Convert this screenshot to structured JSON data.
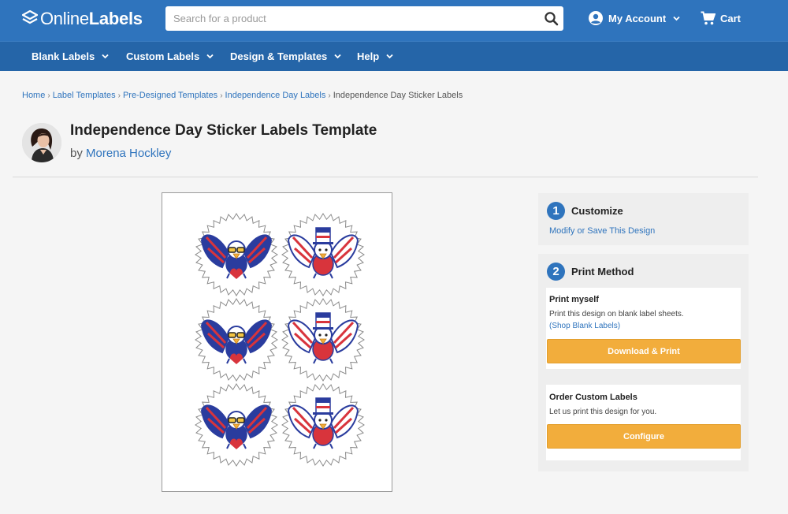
{
  "header": {
    "logo_light": "Online",
    "logo_bold": "Labels",
    "search_placeholder": "Search for a product",
    "account_label": "My Account",
    "cart_label": "Cart"
  },
  "nav": {
    "items": [
      {
        "label": "Blank Labels"
      },
      {
        "label": "Custom Labels"
      },
      {
        "label": "Design & Templates"
      },
      {
        "label": "Help"
      }
    ]
  },
  "breadcrumb": {
    "items": [
      "Home",
      "Label Templates",
      "Pre-Designed Templates",
      "Independence Day Labels"
    ],
    "current": "Independence Day Sticker Labels",
    "separator": "›"
  },
  "page": {
    "title": "Independence Day Sticker Labels Template",
    "by": "by",
    "author": "Morena Hockley"
  },
  "customize": {
    "number": "1",
    "title": "Customize",
    "link": "Modify or Save This Design"
  },
  "print_method": {
    "number": "2",
    "title": "Print Method",
    "print_myself": {
      "title": "Print myself",
      "description": "Print this design on blank label sheets.",
      "link": "(Shop Blank Labels)",
      "button": "Download & Print"
    },
    "order_custom": {
      "title": "Order Custom Labels",
      "description": "Let us print this design for you.",
      "button": "Configure"
    }
  },
  "colors": {
    "brand_blue": "#2f74bd",
    "nav_blue": "#2565a8",
    "button_orange": "#f2ad3c",
    "eagle_blue": "#2a3c9e",
    "eagle_red": "#d8343c"
  },
  "preview": {
    "label_count": 6,
    "designs": [
      "eagle-sunglasses",
      "eagle-top-hat",
      "eagle-sunglasses",
      "eagle-top-hat",
      "eagle-sunglasses",
      "eagle-top-hat"
    ]
  }
}
